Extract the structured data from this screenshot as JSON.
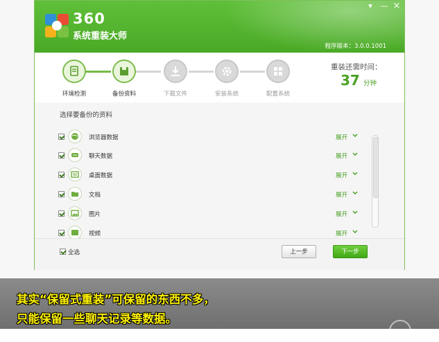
{
  "window": {
    "brand_number": "360",
    "brand_name": "系统重装大师",
    "version": "程序版本：3.0.0.1001",
    "minimize_glyph": "▾",
    "restore_glyph": "—",
    "close_glyph": "×"
  },
  "steps": [
    {
      "label": "环境检测",
      "icon": "monitor-icon",
      "state": "done"
    },
    {
      "label": "备份资料",
      "icon": "backup-icon",
      "state": "current"
    },
    {
      "label": "下载文件",
      "icon": "download-icon",
      "state": "pending"
    },
    {
      "label": "安装系统",
      "icon": "gear-icon",
      "state": "pending"
    },
    {
      "label": "配置系统",
      "icon": "windows-icon",
      "state": "pending"
    }
  ],
  "remaining": {
    "title": "重装还需时间：",
    "value": "37",
    "unit": "分钟"
  },
  "backup": {
    "section_title": "选择要备份的资料",
    "expand_label": "展开",
    "items": [
      {
        "label": "浏览器数据",
        "icon": "browser-globe-icon",
        "checked": true
      },
      {
        "label": "聊天数据",
        "icon": "chat-icon",
        "checked": true
      },
      {
        "label": "桌面数据",
        "icon": "desktop-icon",
        "checked": true
      },
      {
        "label": "文档",
        "icon": "folder-icon",
        "checked": true
      },
      {
        "label": "图片",
        "icon": "image-icon",
        "checked": true
      },
      {
        "label": "视频",
        "icon": "video-icon",
        "checked": true
      }
    ]
  },
  "footer": {
    "select_all": "全选",
    "prev": "上一步",
    "next": "下一步"
  },
  "caption": {
    "line1": "其实“保留式重装”可保留的东西不多，",
    "line2": "只能保留一些聊天记录等数据。"
  },
  "colors": {
    "accent": "#4aa125",
    "caption_text": "#fff200"
  }
}
